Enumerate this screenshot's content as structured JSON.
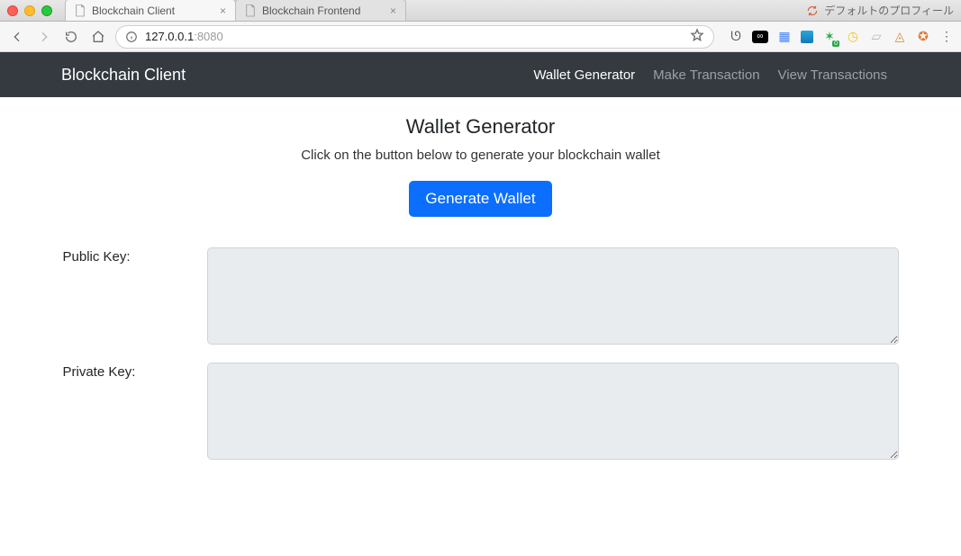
{
  "chrome": {
    "tabs": [
      {
        "title": "Blockchain Client"
      },
      {
        "title": "Blockchain Frontend"
      }
    ],
    "profile_label": "デフォルトのプロフィール",
    "url_host": "127.0.0.1",
    "url_port": ":8080",
    "ext_icons": [
      "seahorse-icon",
      "mask-icon",
      "keep-icon",
      "trello-icon",
      "bug-green-icon",
      "clock-icon",
      "drive-icon",
      "fox-icon",
      "firefox-icon"
    ]
  },
  "navbar": {
    "brand": "Blockchain Client",
    "links": [
      {
        "label": "Wallet Generator",
        "active": true
      },
      {
        "label": "Make Transaction",
        "active": false
      },
      {
        "label": "View Transactions",
        "active": false
      }
    ]
  },
  "page": {
    "title": "Wallet Generator",
    "subtitle": "Click on the button below to generate your blockchain wallet",
    "generate_label": "Generate Wallet",
    "public_key_label": "Public Key:",
    "public_key_value": "",
    "private_key_label": "Private Key:",
    "private_key_value": ""
  }
}
